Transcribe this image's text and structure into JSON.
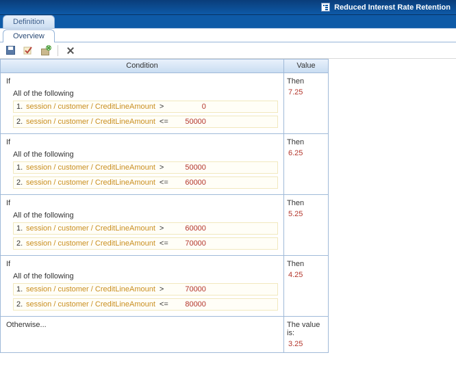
{
  "title": "Reduced Interest Rate Retention",
  "tabs": {
    "definition": "Definition",
    "overview": "Overview"
  },
  "columns": {
    "condition": "Condition",
    "value": "Value"
  },
  "labels": {
    "if": "If",
    "all": "All of the following",
    "then": "Then",
    "otherwise": "Otherwise...",
    "otherwise_value_prefix": "The value is:"
  },
  "cond_path": "session / customer / CreditLineAmount",
  "rules": [
    {
      "conditions": [
        {
          "num": "1.",
          "op": ">",
          "value": "0"
        },
        {
          "num": "2.",
          "op": "<=",
          "value": "50000"
        }
      ],
      "then": "7.25"
    },
    {
      "conditions": [
        {
          "num": "1.",
          "op": ">",
          "value": "50000"
        },
        {
          "num": "2.",
          "op": "<=",
          "value": "60000"
        }
      ],
      "then": "6.25"
    },
    {
      "conditions": [
        {
          "num": "1.",
          "op": ">",
          "value": "60000"
        },
        {
          "num": "2.",
          "op": "<=",
          "value": "70000"
        }
      ],
      "then": "5.25"
    },
    {
      "conditions": [
        {
          "num": "1.",
          "op": ">",
          "value": "70000"
        },
        {
          "num": "2.",
          "op": "<=",
          "value": "80000"
        }
      ],
      "then": "4.25"
    }
  ],
  "otherwise_value": "3.25"
}
